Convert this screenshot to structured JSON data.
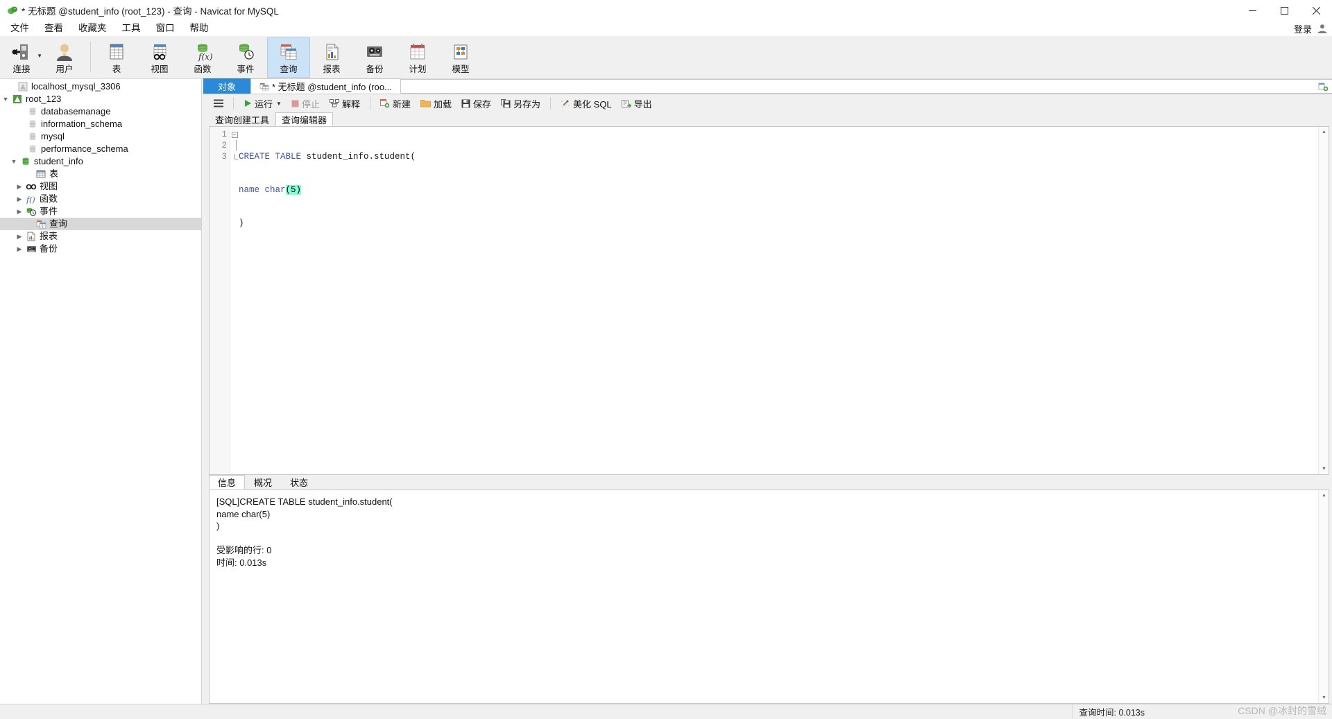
{
  "window": {
    "title": "* 无标题 @student_info (root_123) - 查询 - Navicat for MySQL",
    "minimize": "—",
    "maximize": "□",
    "close": "✕"
  },
  "menubar": {
    "items": [
      {
        "label": "文件"
      },
      {
        "label": "查看"
      },
      {
        "label": "收藏夹"
      },
      {
        "label": "工具"
      },
      {
        "label": "窗口"
      },
      {
        "label": "帮助"
      }
    ],
    "login_label": "登录"
  },
  "toolbar": {
    "items": [
      {
        "label": "连接",
        "icon": "connection-icon",
        "has_caret": true,
        "active": false
      },
      {
        "label": "用户",
        "icon": "user-icon",
        "has_caret": false,
        "active": false
      },
      {
        "label": "表",
        "icon": "table-icon",
        "has_caret": false,
        "active": false
      },
      {
        "label": "视图",
        "icon": "view-icon",
        "has_caret": false,
        "active": false
      },
      {
        "label": "函数",
        "icon": "function-icon",
        "has_caret": false,
        "active": false
      },
      {
        "label": "事件",
        "icon": "event-icon",
        "has_caret": false,
        "active": false
      },
      {
        "label": "查询",
        "icon": "query-icon",
        "has_caret": false,
        "active": true
      },
      {
        "label": "报表",
        "icon": "report-icon",
        "has_caret": false,
        "active": false
      },
      {
        "label": "备份",
        "icon": "backup-icon",
        "has_caret": false,
        "active": false
      },
      {
        "label": "计划",
        "icon": "schedule-icon",
        "has_caret": false,
        "active": false
      },
      {
        "label": "模型",
        "icon": "model-icon",
        "has_caret": false,
        "active": false
      }
    ]
  },
  "sidebar": {
    "nodes": [
      {
        "label": "localhost_mysql_3306",
        "indent": 1,
        "twisty": "",
        "icon": "connection-gray-icon",
        "selected": false
      },
      {
        "label": "root_123",
        "indent": 0,
        "twisty": "expanded",
        "icon": "connection-green-icon",
        "selected": false
      },
      {
        "label": "databasemanage",
        "indent": 2,
        "twisty": "",
        "icon": "database-gray-icon",
        "selected": false
      },
      {
        "label": "information_schema",
        "indent": 2,
        "twisty": "",
        "icon": "database-gray-icon",
        "selected": false
      },
      {
        "label": "mysql",
        "indent": 2,
        "twisty": "",
        "icon": "database-gray-icon",
        "selected": false
      },
      {
        "label": "performance_schema",
        "indent": 2,
        "twisty": "",
        "icon": "database-gray-icon",
        "selected": false
      },
      {
        "label": "student_info",
        "indent": 1,
        "twisty": "expanded",
        "icon": "database-green-icon",
        "selected": false
      },
      {
        "label": "表",
        "indent": 3,
        "twisty": "",
        "icon": "table-icon",
        "selected": false
      },
      {
        "label": "视图",
        "indent": 2,
        "twisty": "collapsed",
        "icon": "view-icon",
        "selected": false
      },
      {
        "label": "函数",
        "indent": 2,
        "twisty": "collapsed",
        "icon": "function-icon",
        "selected": false
      },
      {
        "label": "事件",
        "indent": 2,
        "twisty": "collapsed",
        "icon": "event-icon",
        "selected": false
      },
      {
        "label": "查询",
        "indent": 3,
        "twisty": "",
        "icon": "query-icon",
        "selected": true
      },
      {
        "label": "报表",
        "indent": 2,
        "twisty": "collapsed",
        "icon": "report-icon",
        "selected": false
      },
      {
        "label": "备份",
        "indent": 2,
        "twisty": "collapsed",
        "icon": "backup-icon",
        "selected": false
      }
    ]
  },
  "doc_tabs": {
    "object_tab": "对象",
    "query_tab": "* 无标题 @student_info (roo...",
    "new_tab_icon": "add-tab-icon"
  },
  "query_toolbar": {
    "menu_icon": "hamburger-icon",
    "buttons": [
      {
        "label": "运行",
        "icon": "run-icon",
        "caret": true,
        "disabled": false
      },
      {
        "label": "停止",
        "icon": "stop-icon",
        "caret": false,
        "disabled": true
      },
      {
        "label": "解释",
        "icon": "explain-icon",
        "caret": false,
        "disabled": false
      },
      {
        "label": "新建",
        "icon": "new-icon",
        "caret": false,
        "disabled": false
      },
      {
        "label": "加载",
        "icon": "load-icon",
        "caret": false,
        "disabled": false
      },
      {
        "label": "保存",
        "icon": "save-icon",
        "caret": false,
        "disabled": false
      },
      {
        "label": "另存为",
        "icon": "save-as-icon",
        "caret": false,
        "disabled": false
      },
      {
        "label": "美化 SQL",
        "icon": "beautify-icon",
        "caret": false,
        "disabled": false
      },
      {
        "label": "导出",
        "icon": "export-icon",
        "caret": false,
        "disabled": false
      }
    ]
  },
  "editor_tabs": [
    {
      "label": "查询创建工具",
      "active": false
    },
    {
      "label": "查询编辑器",
      "active": true
    }
  ],
  "editor": {
    "line_numbers": [
      "1",
      "2",
      "3"
    ],
    "lines": [
      {
        "tokens": [
          {
            "t": "CREATE TABLE",
            "c": "k"
          },
          {
            "t": " student_info.student(",
            "c": "t"
          }
        ]
      },
      {
        "tokens": [
          {
            "t": "name",
            "c": "k"
          },
          {
            "t": " ",
            "c": "t"
          },
          {
            "t": "char",
            "c": "fn"
          },
          {
            "t": "(5)",
            "c": "hl"
          }
        ]
      },
      {
        "tokens": [
          {
            "t": ")",
            "c": "t"
          }
        ]
      }
    ],
    "plain": "CREATE TABLE student_info.student(\nname char(5)\n)"
  },
  "results": {
    "tabs": [
      {
        "label": "信息",
        "active": true
      },
      {
        "label": "概况",
        "active": false
      },
      {
        "label": "状态",
        "active": false
      }
    ],
    "message_lines": [
      "[SQL]CREATE TABLE student_info.student(",
      "name char(5)",
      ")",
      "",
      "受影响的行: 0",
      "时间: 0.013s"
    ]
  },
  "statusbar": {
    "query_time_label": "查询时间: 0.013s",
    "watermark": "CSDN @冰封的雪绒"
  },
  "colors": {
    "accent_blue": "#2b8ad8",
    "toolbar_active": "#cce3f7",
    "keyword_blue": "#3b4ec8",
    "highlight_cyan": "#7fffd4",
    "tree_selected": "#d8d8d8",
    "green": "#4a9c3c"
  }
}
